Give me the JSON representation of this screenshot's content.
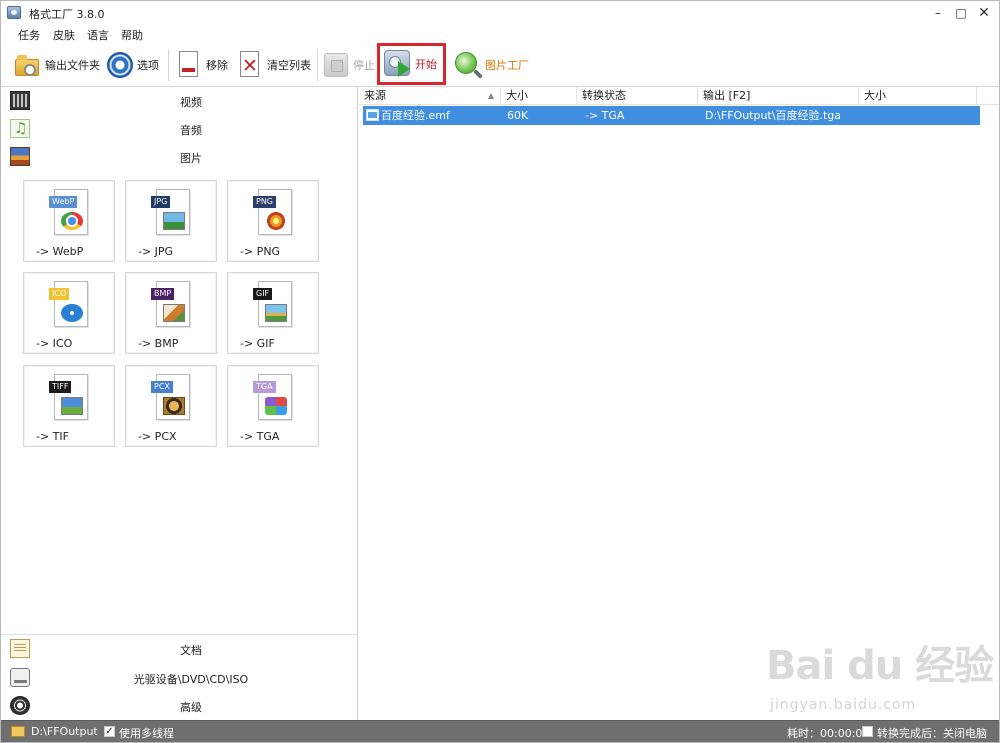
{
  "window": {
    "title": "格式工厂 3.8.0",
    "controls": {
      "minimize": "–",
      "maximize": "□",
      "close": "✕"
    }
  },
  "menu": [
    "任务",
    "皮肤",
    "语言",
    "帮助"
  ],
  "toolbar": {
    "output_folder": "输出文件夹",
    "options": "选项",
    "remove": "移除",
    "clear_list": "清空列表",
    "stop": "停止",
    "start": "开始",
    "picture_factory": "图片工厂"
  },
  "categories": {
    "video": "视频",
    "audio": "音频",
    "image": "图片",
    "document": "文档",
    "disc": "光驱设备\\DVD\\CD\\ISO",
    "advanced": "高级"
  },
  "formats": [
    {
      "tag": "WebP",
      "label": "-> WebP",
      "tag_color": "#5b8fd3"
    },
    {
      "tag": "JPG",
      "label": "-> JPG",
      "tag_color": "#1f3b63"
    },
    {
      "tag": "PNG",
      "label": "-> PNG",
      "tag_color": "#2c3e6b"
    },
    {
      "tag": "ICO",
      "label": "-> ICO",
      "tag_color": "#f2c230"
    },
    {
      "tag": "BMP",
      "label": "-> BMP",
      "tag_color": "#4a1f63"
    },
    {
      "tag": "GIF",
      "label": "-> GIF",
      "tag_color": "#1a1a1a"
    },
    {
      "tag": "TIFF",
      "label": "-> TIF",
      "tag_color": "#1a1a1a"
    },
    {
      "tag": "PCX",
      "label": "-> PCX",
      "tag_color": "#4a7fd0"
    },
    {
      "tag": "TGA",
      "label": "-> TGA",
      "tag_color": "#b79ad8"
    }
  ],
  "list": {
    "columns": [
      "来源",
      "大小",
      "转换状态",
      "输出 [F2]",
      "大小"
    ],
    "rows": [
      {
        "source": "百度经验.emf",
        "size": "60K",
        "status": "-> TGA",
        "output": "D:\\FFOutput\\百度经验.tga",
        "out_size": ""
      }
    ],
    "selected_color": "#3f8ee0"
  },
  "statusbar": {
    "output_path": "D:\\FFOutput",
    "multithread_label": "使用多线程",
    "multithread_checked": "✓",
    "elapsed": "耗时：00:00:01",
    "after_done": "转换完成后：关闭电脑",
    "after_done_checked": ""
  },
  "watermark": {
    "logo": "Bai du 经验",
    "url": "jingyan.baidu.com"
  },
  "icons": {
    "app": "format-factory-icon",
    "output_folder": "folder-icon",
    "options": "gear-icon",
    "remove": "remove-doc-icon",
    "clear_list": "clear-list-icon",
    "stop": "stop-icon",
    "start": "start-icon",
    "picture_factory": "magnifier-icon"
  },
  "colors": {
    "highlight_border": "#d9262c",
    "statusbar": "#6f6f6f",
    "picture_factory_label": "#d37a00"
  }
}
